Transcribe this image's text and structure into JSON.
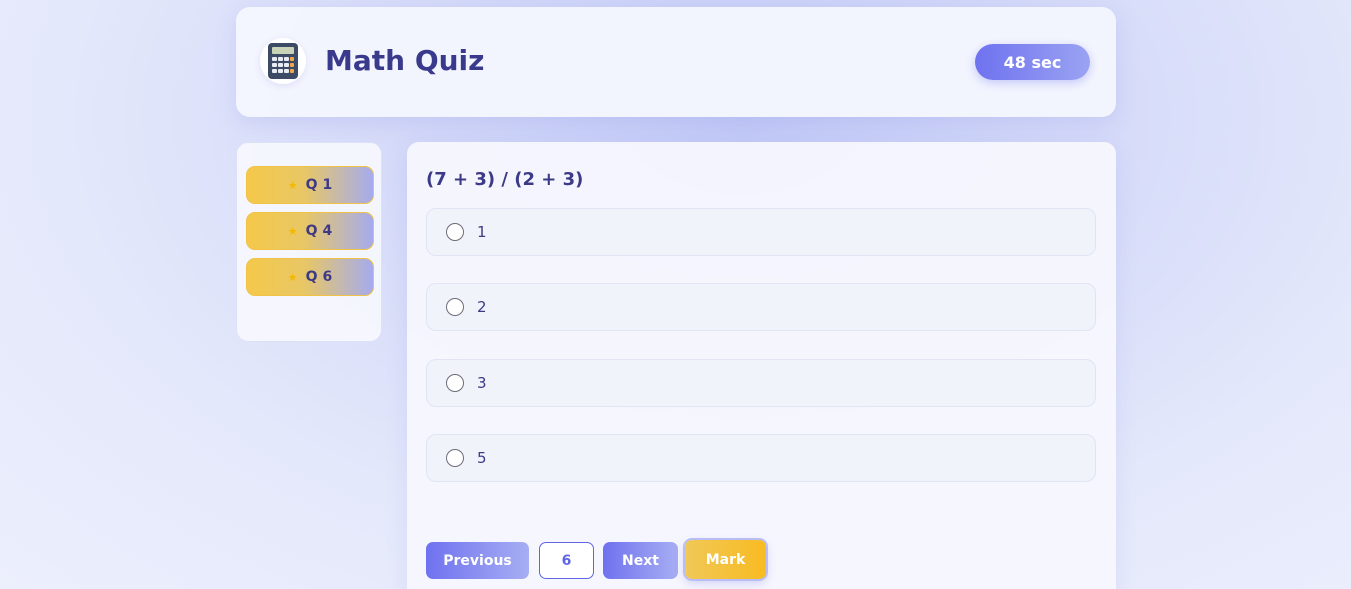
{
  "header": {
    "app_icon": "calculator-icon",
    "title": "Math Quiz",
    "timer": "48 sec"
  },
  "sidebar": {
    "marked_icon": "star-icon",
    "items": [
      {
        "label": "Q 1"
      },
      {
        "label": "Q 4"
      },
      {
        "label": "Q 6"
      }
    ]
  },
  "question": {
    "text": "(7 + 3) / (2 + 3)",
    "options": [
      {
        "label": "1"
      },
      {
        "label": "2"
      },
      {
        "label": "3"
      },
      {
        "label": "5"
      }
    ]
  },
  "controls": {
    "previous_label": "Previous",
    "page_number": "6",
    "next_label": "Next",
    "mark_label": "Mark"
  },
  "colors": {
    "accent": "#6f72ef",
    "mark": "#f8bb22",
    "title": "#3a3a8c"
  }
}
